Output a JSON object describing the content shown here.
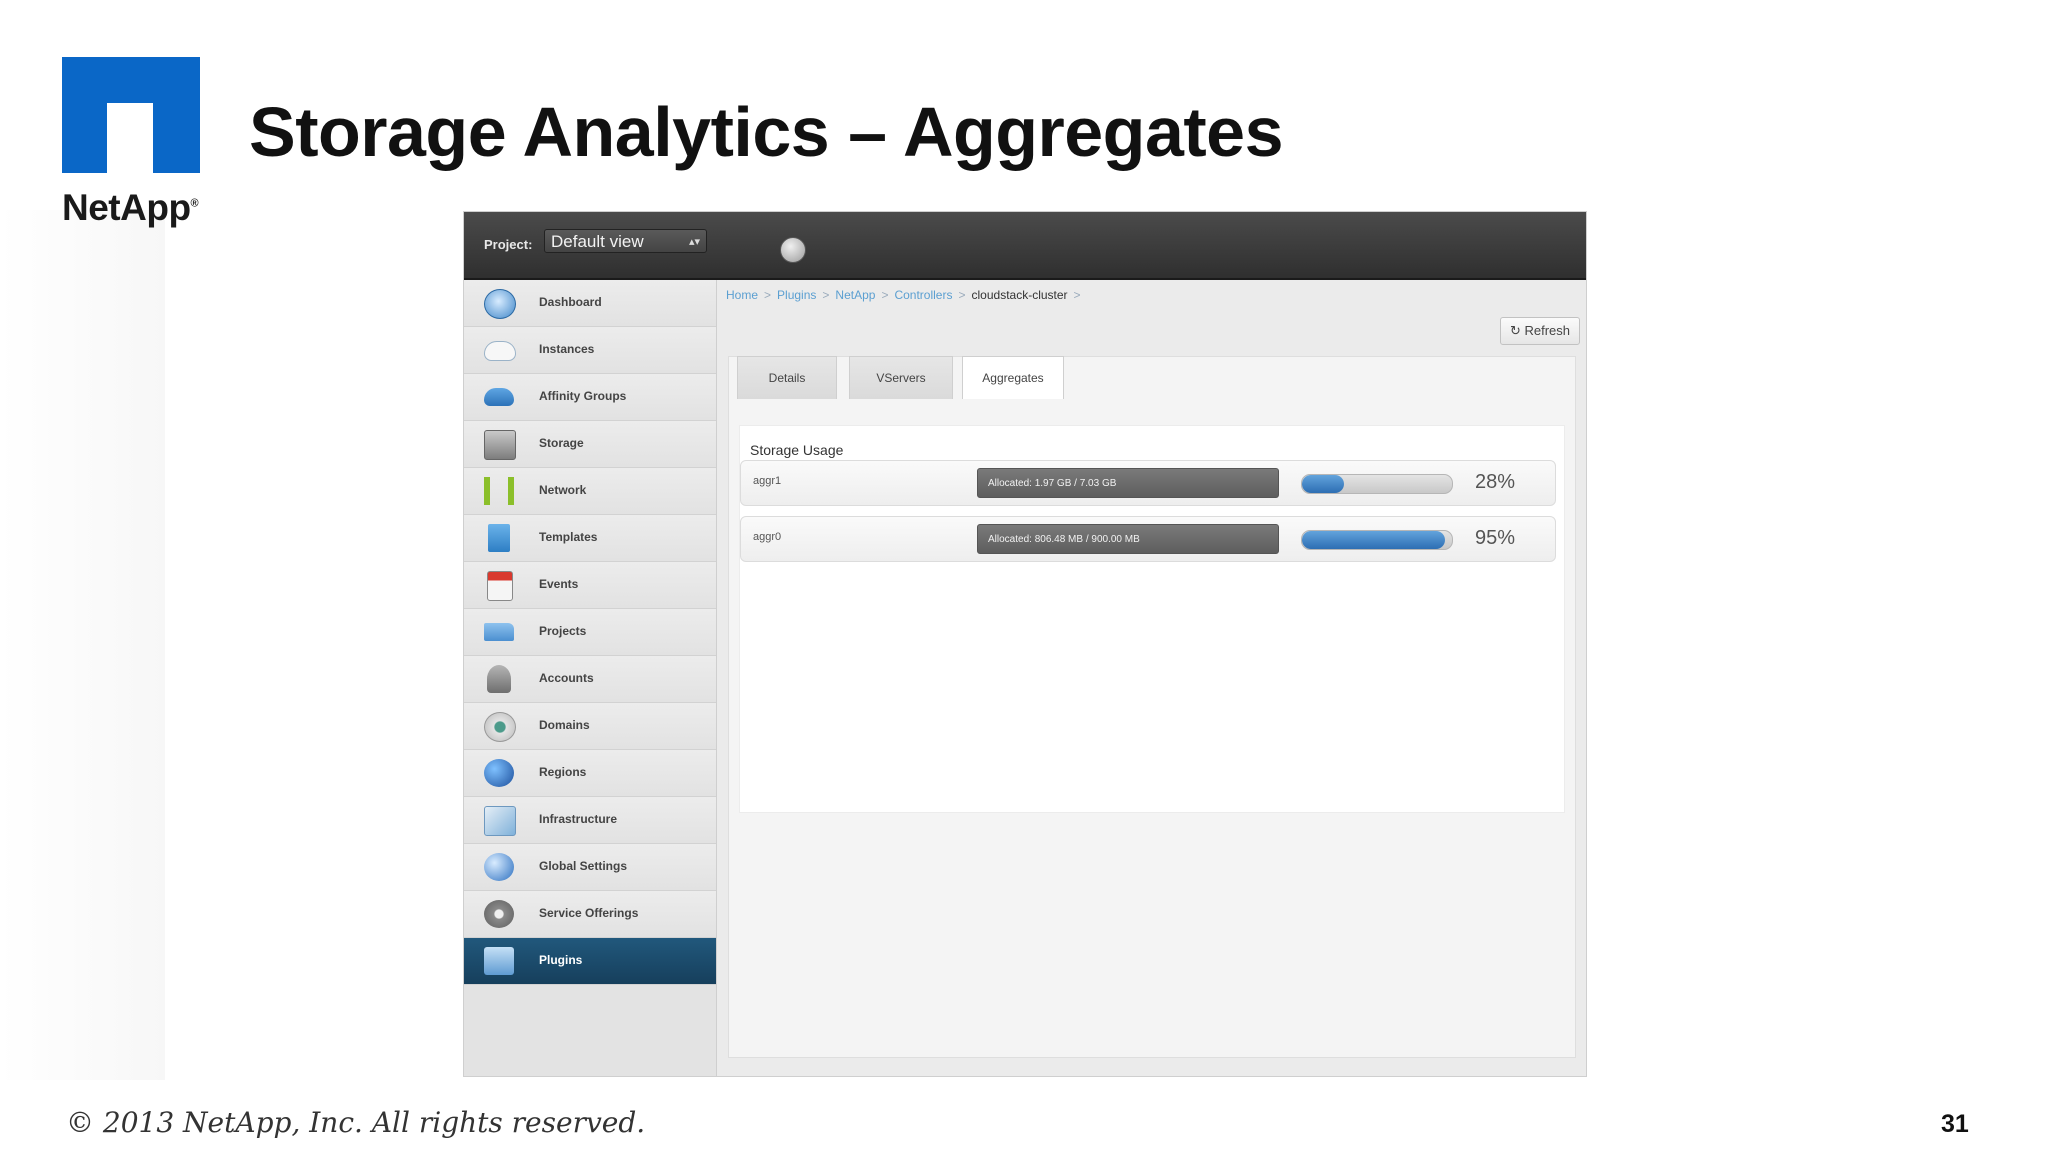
{
  "brand": {
    "name": "NetApp",
    "mark": "®"
  },
  "slide": {
    "title": "Storage Analytics – Aggregates",
    "footer": "© 2013 NetApp, Inc. All rights reserved.",
    "page_number": "31"
  },
  "topbar": {
    "project_label": "Project:",
    "project_value": "Default view"
  },
  "sidebar": {
    "items": [
      {
        "label": "Dashboard",
        "icon": "dashboard-icon"
      },
      {
        "label": "Instances",
        "icon": "cloud-icon"
      },
      {
        "label": "Affinity Groups",
        "icon": "affinity-groups-icon"
      },
      {
        "label": "Storage",
        "icon": "storage-icon"
      },
      {
        "label": "Network",
        "icon": "network-icon"
      },
      {
        "label": "Templates",
        "icon": "templates-icon"
      },
      {
        "label": "Events",
        "icon": "calendar-icon"
      },
      {
        "label": "Projects",
        "icon": "folder-icon"
      },
      {
        "label": "Accounts",
        "icon": "user-icon"
      },
      {
        "label": "Domains",
        "icon": "domains-icon"
      },
      {
        "label": "Regions",
        "icon": "globe-icon"
      },
      {
        "label": "Infrastructure",
        "icon": "infrastructure-icon"
      },
      {
        "label": "Global Settings",
        "icon": "global-settings-icon"
      },
      {
        "label": "Service Offerings",
        "icon": "gear-icon"
      },
      {
        "label": "Plugins",
        "icon": "plugins-icon"
      }
    ],
    "active": "Plugins"
  },
  "breadcrumb": [
    "Home",
    "Plugins",
    "NetApp",
    "Controllers",
    "cloudstack-cluster"
  ],
  "refresh_label": "Refresh",
  "tabs": [
    "Details",
    "VServers",
    "Aggregates"
  ],
  "active_tab": "Aggregates",
  "storage": {
    "title": "Storage Usage",
    "aggregates": [
      {
        "name": "aggr1",
        "allocated": "Allocated: 1.97 GB / 7.03 GB",
        "percent": "28%",
        "fill": 0.28
      },
      {
        "name": "aggr0",
        "allocated": "Allocated: 806.48 MB / 900.00 MB",
        "percent": "95%",
        "fill": 0.95
      }
    ]
  },
  "colors": {
    "brand_blue": "#0a67c7",
    "active_nav": "#1b4b6e",
    "progress_blue": "#2d6eb3"
  }
}
